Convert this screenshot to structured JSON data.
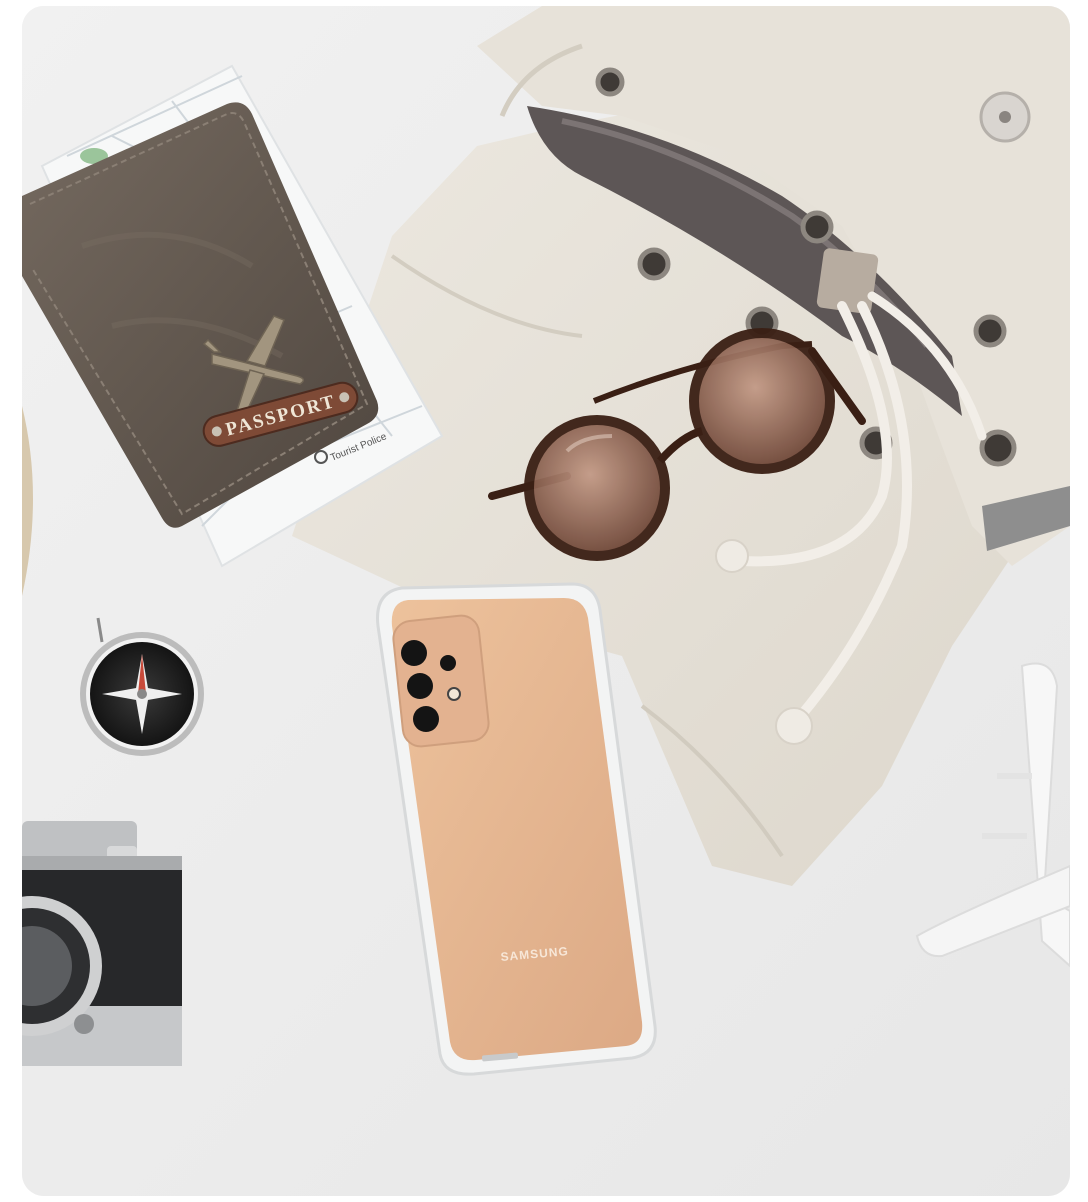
{
  "photo": {
    "background_color": "#ececec",
    "objects": [
      {
        "name": "passport-holder",
        "embossed_text": "PASSPORT",
        "color": "#6e6258"
      },
      {
        "name": "folded-map",
        "printed_text": "Tourist Police"
      },
      {
        "name": "canvas-backpack",
        "color": "#e6e1d8"
      },
      {
        "name": "sunglasses",
        "frame_color": "#3a1f14",
        "lens_color": "#9a6a52"
      },
      {
        "name": "smartphone-with-clear-case",
        "brand_text": "SAMSUNG",
        "color": "#e6b48c"
      },
      {
        "name": "compass"
      },
      {
        "name": "film-camera"
      },
      {
        "name": "toy-airplane",
        "color": "#f7f7f7"
      }
    ]
  }
}
